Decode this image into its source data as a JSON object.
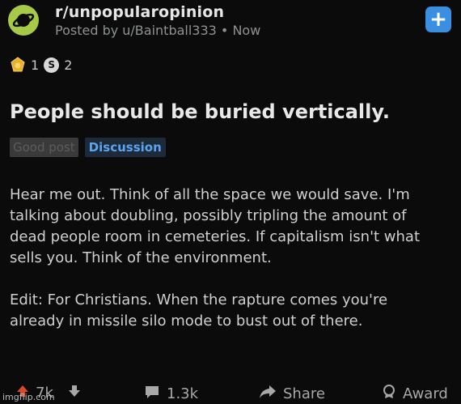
{
  "post": {
    "subreddit": "r/unpopularopinion",
    "posted_by": "Posted by u/Baintball333 • Now",
    "awards": [
      {
        "icon": "gold-award-icon",
        "count": "1"
      },
      {
        "icon": "silver-award-icon",
        "count": "2"
      }
    ],
    "title": "People should be buried vertically.",
    "flairs": [
      "Good post",
      "Discussion"
    ],
    "body": [
      "Hear me out. Think of all the space we would save. I'm talking about doubling, possibly tripling the amount of dead people room in cemeteries. If capitalism isn't what sells you. Think of the environment.",
      "Edit: For Christians. When the rapture comes you're already in missile silo mode to bust out of there."
    ],
    "vote_count": "7k",
    "comment_count": "1.3k",
    "share_label": "Share",
    "award_label": "Award"
  },
  "watermark": "imgflip.com",
  "colors": {
    "accent": "#3a8fe0",
    "flair": "#5aa5ee",
    "background": "#0b0b0b"
  }
}
